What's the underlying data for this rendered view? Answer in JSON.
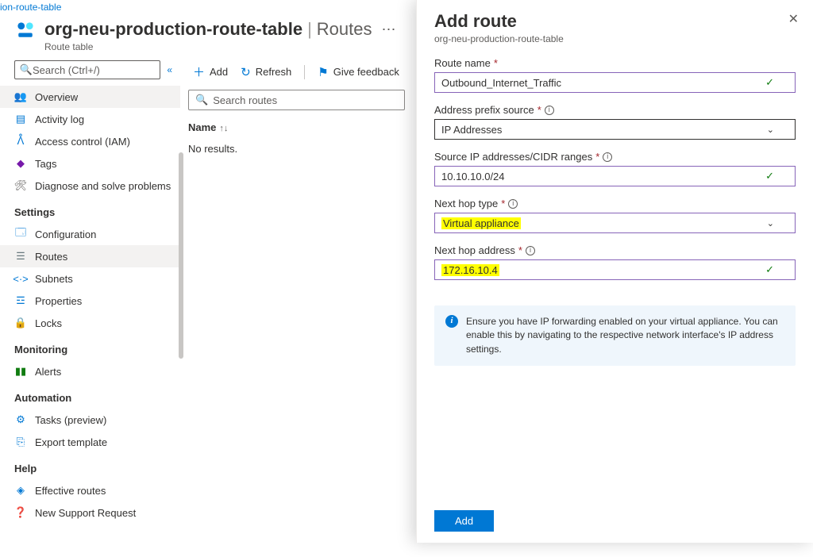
{
  "breadcrumb": "ion-route-table",
  "header": {
    "title": "org-neu-production-route-table",
    "section": "Routes",
    "subtitle": "Route table"
  },
  "sidebar": {
    "search_placeholder": "Search (Ctrl+/)",
    "items": [
      {
        "icon": "people",
        "label": "Overview",
        "active": true
      },
      {
        "icon": "log",
        "label": "Activity log"
      },
      {
        "icon": "iam",
        "label": "Access control (IAM)"
      },
      {
        "icon": "tag",
        "label": "Tags"
      },
      {
        "icon": "diag",
        "label": "Diagnose and solve problems"
      }
    ],
    "settings_title": "Settings",
    "settings": [
      {
        "icon": "config",
        "label": "Configuration"
      },
      {
        "icon": "routes",
        "label": "Routes",
        "active": true
      },
      {
        "icon": "subnets",
        "label": "Subnets"
      },
      {
        "icon": "props",
        "label": "Properties"
      },
      {
        "icon": "locks",
        "label": "Locks"
      }
    ],
    "monitoring_title": "Monitoring",
    "monitoring": [
      {
        "icon": "alerts",
        "label": "Alerts"
      }
    ],
    "automation_title": "Automation",
    "automation": [
      {
        "icon": "tasks",
        "label": "Tasks (preview)"
      },
      {
        "icon": "export",
        "label": "Export template"
      }
    ],
    "help_title": "Help",
    "help": [
      {
        "icon": "eff",
        "label": "Effective routes"
      },
      {
        "icon": "support",
        "label": "New Support Request"
      }
    ]
  },
  "toolbar": {
    "add": "Add",
    "refresh": "Refresh",
    "feedback": "Give feedback"
  },
  "routes": {
    "search_placeholder": "Search routes",
    "col_name": "Name",
    "no_results": "No results."
  },
  "panel": {
    "title": "Add route",
    "subtitle": "org-neu-production-route-table",
    "fields": {
      "route_name": {
        "label": "Route name",
        "value": "Outbound_Internet_Traffic"
      },
      "prefix_source": {
        "label": "Address prefix source",
        "value": "IP Addresses"
      },
      "cidr": {
        "label": "Source IP addresses/CIDR ranges",
        "value": "10.10.10.0/24"
      },
      "next_hop_type": {
        "label": "Next hop type",
        "value": "Virtual appliance"
      },
      "next_hop_addr": {
        "label": "Next hop address",
        "value": "172.16.10.4"
      }
    },
    "info": "Ensure you have IP forwarding enabled on your virtual appliance. You can enable this by navigating to the respective network interface's IP address settings.",
    "add_button": "Add"
  }
}
